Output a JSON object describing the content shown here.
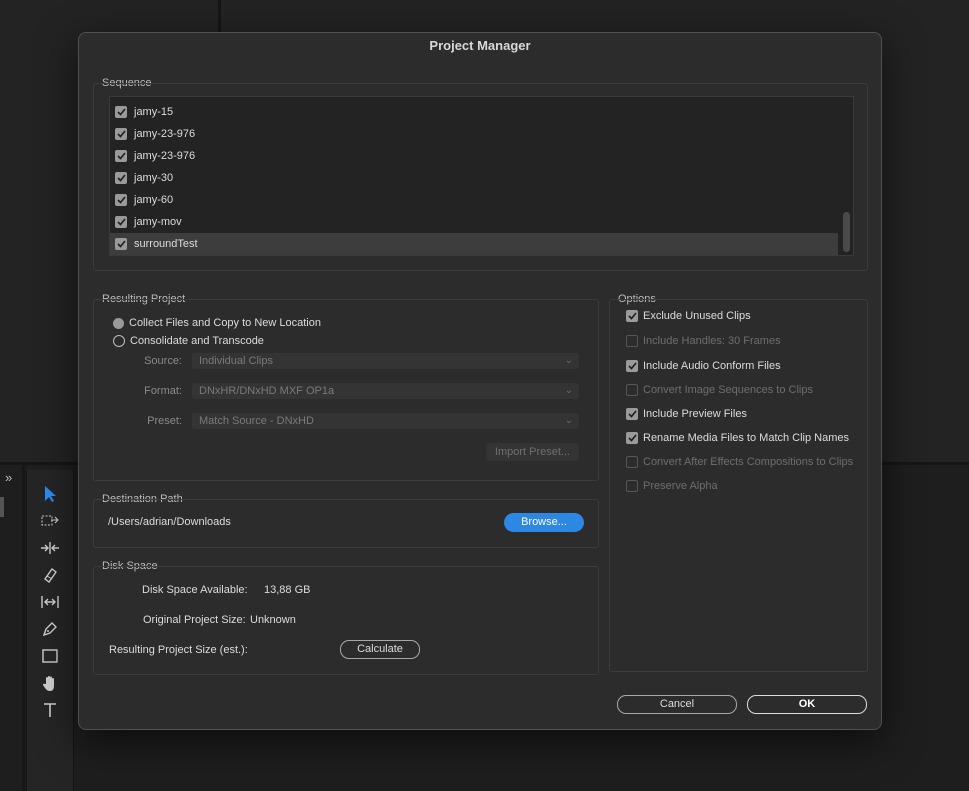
{
  "dialog": {
    "title": "Project Manager"
  },
  "sequence": {
    "title": "Sequence",
    "items": [
      {
        "label": "jamy-15",
        "checked": true
      },
      {
        "label": "jamy-23-976",
        "checked": true
      },
      {
        "label": "jamy-23-976",
        "checked": true
      },
      {
        "label": "jamy-30",
        "checked": true
      },
      {
        "label": "jamy-60",
        "checked": true
      },
      {
        "label": "jamy-mov",
        "checked": true
      },
      {
        "label": "surroundTest",
        "checked": true,
        "selected": true
      }
    ]
  },
  "resulting_project": {
    "title": "Resulting Project",
    "collect_label": "Collect Files and Copy to New Location",
    "consolidate_label": "Consolidate and Transcode",
    "source_label": "Source:",
    "source_value": "Individual Clips",
    "format_label": "Format:",
    "format_value": "DNxHR/DNxHD MXF OP1a",
    "preset_label": "Preset:",
    "preset_value": "Match Source - DNxHD",
    "import_preset_label": "Import Preset..."
  },
  "options": {
    "title": "Options",
    "items": [
      {
        "label": "Exclude Unused Clips",
        "checked": true,
        "enabled": true
      },
      {
        "label": "Include Handles:  30 Frames",
        "checked": false,
        "enabled": false
      },
      {
        "label": "Include Audio Conform Files",
        "checked": true,
        "enabled": true
      },
      {
        "label": "Convert Image Sequences to Clips",
        "checked": false,
        "enabled": false
      },
      {
        "label": "Include Preview Files",
        "checked": true,
        "enabled": true
      },
      {
        "label": "Rename Media Files to Match Clip Names",
        "checked": true,
        "enabled": true
      },
      {
        "label": "Convert After Effects Compositions to Clips",
        "checked": false,
        "enabled": false
      },
      {
        "label": "Preserve Alpha",
        "checked": false,
        "enabled": false
      }
    ]
  },
  "destination": {
    "title": "Destination Path",
    "path": "/Users/adrian/Downloads",
    "browse_label": "Browse..."
  },
  "disk_space": {
    "title": "Disk Space",
    "available_label": "Disk Space Available:",
    "available_value": "13,88 GB",
    "original_label": "Original Project Size:",
    "original_value": "Unknown",
    "resulting_label": "Resulting Project Size (est.):",
    "calculate_label": "Calculate"
  },
  "footer": {
    "cancel_label": "Cancel",
    "ok_label": "OK"
  },
  "colors": {
    "accent": "#2d88e3",
    "dialog_bg": "#2c2c2c"
  },
  "toolbar": {
    "tools": [
      "selection-tool-icon",
      "track-select-icon",
      "ripple-edit-icon",
      "razor-icon",
      "slip-icon",
      "pen-icon",
      "rectangle-icon",
      "hand-icon",
      "type-icon"
    ]
  }
}
